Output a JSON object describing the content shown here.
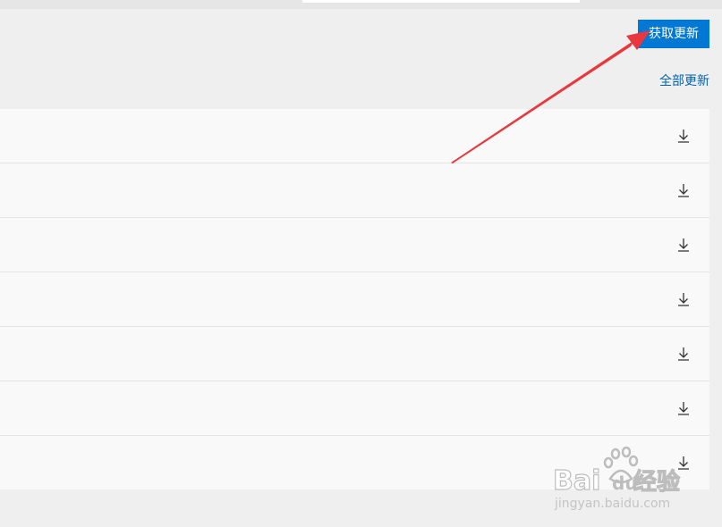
{
  "header": {
    "get_updates_label": "获取更新",
    "update_all_label": "全部更新"
  },
  "list": {
    "rows": [
      {
        "action_icon": "download-icon"
      },
      {
        "action_icon": "download-icon"
      },
      {
        "action_icon": "download-icon"
      },
      {
        "action_icon": "download-icon"
      },
      {
        "action_icon": "download-icon"
      },
      {
        "action_icon": "download-icon"
      },
      {
        "action_icon": "download-icon"
      }
    ]
  },
  "watermark": {
    "brand": "Baidu 经验",
    "url": "jingyan.baidu.com"
  },
  "colors": {
    "accent": "#0078d4",
    "link": "#0063b1",
    "page_bg": "#efefef",
    "list_bg": "#f9f9f9",
    "annotation_arrow": "#e8383d"
  }
}
